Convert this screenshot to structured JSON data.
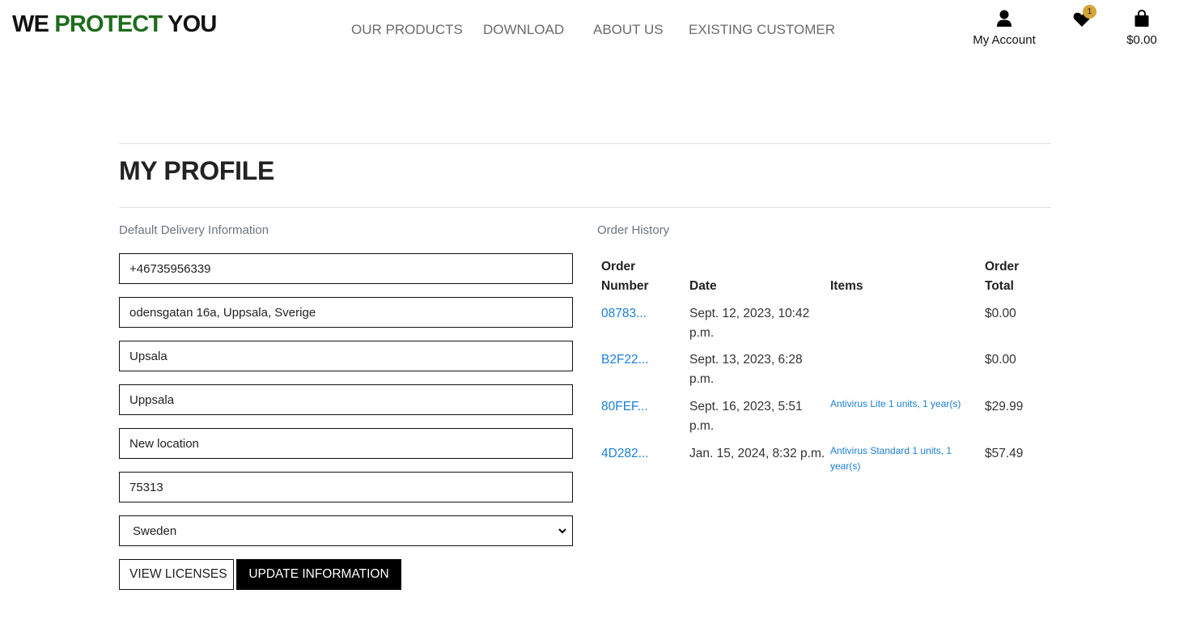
{
  "brand": {
    "part1": "WE ",
    "part2": "PROTECT",
    "part3": " YOU"
  },
  "nav": {
    "items": [
      {
        "label": "OUR PRODUCTS"
      },
      {
        "label": "DOWNLOAD"
      },
      {
        "label": "ABOUT US"
      },
      {
        "label": "EXISTING CUSTOMER"
      }
    ]
  },
  "header": {
    "account_label": "My Account",
    "account_icon": "user-icon",
    "wishlist_icon": "heart-icon",
    "wishlist_count": "1",
    "cart_icon": "shopping-bag-icon",
    "cart_total": "$0.00",
    "badge_color": "#d4a43a"
  },
  "page": {
    "title": "MY PROFILE"
  },
  "delivery": {
    "label": "Default Delivery Information",
    "phone": "+46735956339",
    "street_address": "odensgatan 16a, Uppsala, Sverige",
    "town": "Upsala",
    "county": "Uppsala",
    "street_address2": "New location",
    "postcode": "75313",
    "country": "Sweden"
  },
  "buttons": {
    "view_licenses": "VIEW LICENSES",
    "update_information": "UPDATE INFORMATION"
  },
  "orders": {
    "label": "Order History",
    "headers": {
      "number_line1": "Order",
      "number_line2": "Number",
      "date": "Date",
      "items": "Items",
      "total_line1": "Order",
      "total_line2": "Total"
    },
    "rows": [
      {
        "number": "08783...",
        "date_line1": "Sept. 12, 2023, 10:42",
        "date_line2": "p.m.",
        "items_line1": "",
        "items_line2": "",
        "total": "$0.00"
      },
      {
        "number": "B2F22...",
        "date_line1": "Sept. 13, 2023, 6:28",
        "date_line2": "p.m.",
        "items_line1": "",
        "items_line2": "",
        "total": "$0.00"
      },
      {
        "number": "80FEF...",
        "date_line1": "Sept. 16, 2023, 5:51",
        "date_line2": "p.m.",
        "items_line1": "Antivirus Lite 1 units, 1 year(s)",
        "items_line2": "",
        "total": "$29.99"
      },
      {
        "number": "4D282...",
        "date_line1": "Jan. 15, 2024, 8:32 p.m.",
        "date_line2": "",
        "items_line1": "Antivirus Standard 1 units, 1",
        "items_line2": "year(s)",
        "total": "$57.49"
      }
    ]
  },
  "colors": {
    "brand_green": "#1f6b1f",
    "link_blue": "#1a7fd6",
    "muted_gray": "#6c757d"
  }
}
